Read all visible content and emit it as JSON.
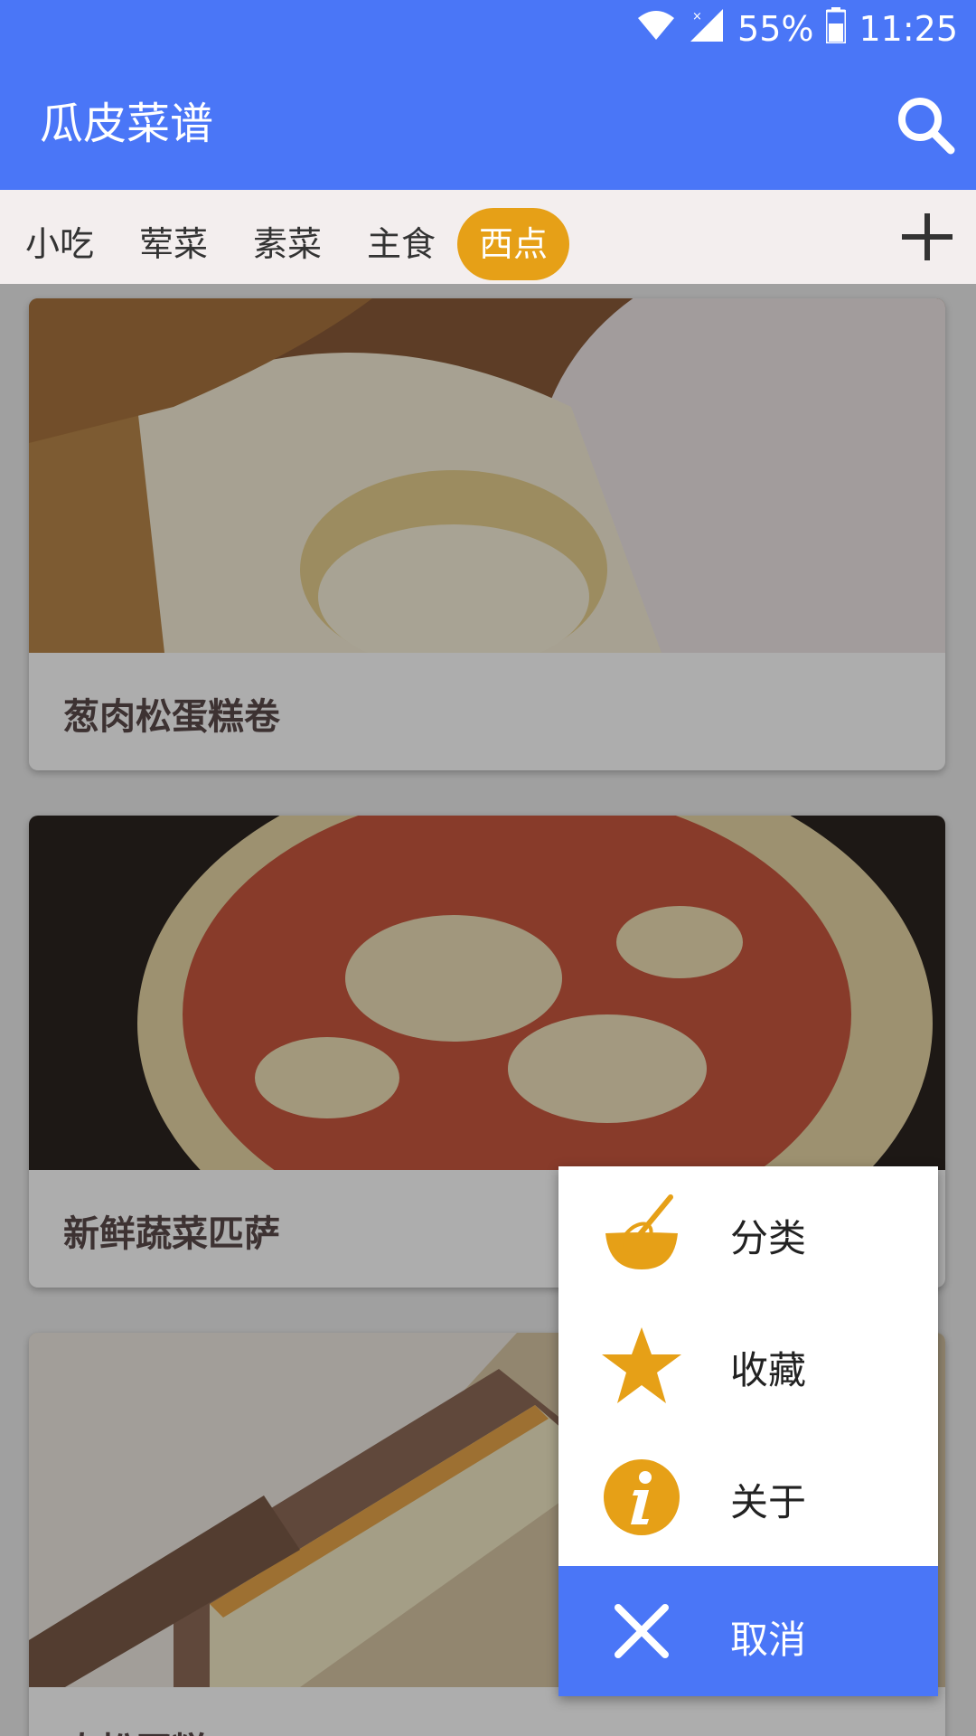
{
  "status_bar": {
    "battery": "55%",
    "time": "11:25"
  },
  "app_bar": {
    "title": "瓜皮菜谱"
  },
  "tabs": [
    {
      "label": "小吃",
      "active": false
    },
    {
      "label": "荤菜",
      "active": false
    },
    {
      "label": "素菜",
      "active": false
    },
    {
      "label": "主食",
      "active": false
    },
    {
      "label": "西点",
      "active": true
    }
  ],
  "recipes": [
    {
      "title": "葱肉松蛋糕卷"
    },
    {
      "title": "新鲜蔬菜匹萨"
    },
    {
      "title": "肉松蛋糕"
    }
  ],
  "menu": {
    "items": [
      {
        "label": "分类",
        "icon": "whisk-bowl-icon"
      },
      {
        "label": "收藏",
        "icon": "star-icon"
      },
      {
        "label": "关于",
        "icon": "info-icon"
      }
    ],
    "cancel": {
      "label": "取消",
      "icon": "close-icon"
    }
  },
  "colors": {
    "primary": "#4a76f7",
    "accent": "#e6a017"
  }
}
